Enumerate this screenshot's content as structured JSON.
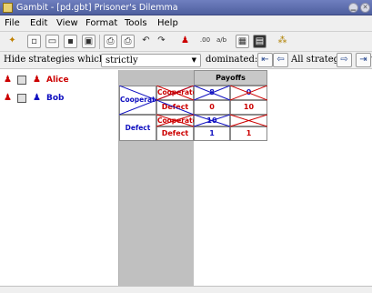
{
  "window": {
    "title": "Gambit - [pd.gbt] Prisoner's Dilemma"
  },
  "menu": [
    "File",
    "Edit",
    "View",
    "Format",
    "Tools",
    "Help"
  ],
  "toolbar_icons": [
    "logo-icon",
    "new-file-icon",
    "open-folder-icon",
    "save-icon",
    "save-as-icon",
    "print-preview-icon",
    "print-icon",
    "undo-icon",
    "redo-icon",
    "add-player-icon",
    "decimal-display-icon",
    "rational-display-icon",
    "equilibria-icon",
    "calculator-icon",
    "tree-icon"
  ],
  "filter": {
    "label": "Hide strategies which are",
    "mode": "strictly",
    "suffix": "dominated:",
    "status": "All strategies shown"
  },
  "players": [
    {
      "name": "Alice",
      "color": "#cc0000"
    },
    {
      "name": "Bob",
      "color": "#1010c0"
    }
  ],
  "table": {
    "header": "Payoffs",
    "row_player_strategies": [
      "Cooperate",
      "Defect"
    ],
    "col_player_strategies": [
      "Cooperate",
      "Defect"
    ],
    "payoffs": [
      [
        {
          "alice": "8",
          "bob": "8",
          "struck": true
        },
        {
          "alice": "0",
          "bob": "10",
          "struck": true
        }
      ],
      [
        {
          "alice": "10",
          "bob": "0",
          "struck": true
        },
        {
          "alice": "1",
          "bob": "1",
          "struck": false
        }
      ]
    ]
  },
  "colors": {
    "alice": "#cc0000",
    "bob": "#1010c0",
    "titlebar": "#5a6aa8"
  }
}
